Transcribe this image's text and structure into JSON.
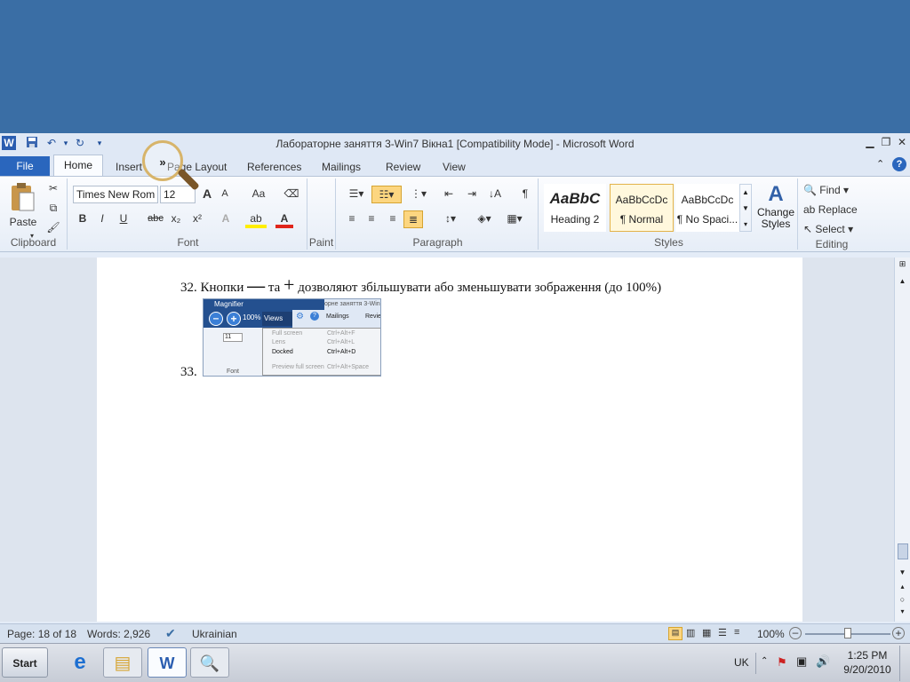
{
  "window": {
    "title": "Лабораторне заняття 3-Win7 Вікна1 [Compatibility Mode]  -  Microsoft Word",
    "app_icon": "W"
  },
  "quick_access": {
    "icons": [
      "word-icon",
      "save-icon",
      "undo-icon",
      "redo-icon",
      "customize-icon"
    ]
  },
  "tabs": [
    "File",
    "Home",
    "Insert",
    "Page Layout",
    "References",
    "Mailings",
    "Review",
    "View"
  ],
  "ribbon": {
    "clipboard": {
      "paste": "Paste",
      "label": "Clipboard"
    },
    "font": {
      "name": "Times New Rom",
      "size": "12",
      "label": "Font",
      "bold": "B",
      "italic": "I",
      "underline": "U",
      "strike": "abc",
      "sub": "x₂",
      "sup": "x²",
      "grow": "A",
      "shrink": "A",
      "case": "Aa"
    },
    "paint": {
      "label": "Paint"
    },
    "paragraph": {
      "label": "Paragraph"
    },
    "styles": {
      "label": "Styles",
      "items": [
        {
          "preview": "AaBbC",
          "name": "Heading 2"
        },
        {
          "preview": "AaBbCcDc",
          "name": "¶ Normal"
        },
        {
          "preview": "AaBbCcDc",
          "name": "¶ No Spaci..."
        }
      ],
      "change": "Change Styles"
    },
    "editing": {
      "label": "Editing",
      "find": "Find",
      "replace": "Replace",
      "select": "Select"
    }
  },
  "document": {
    "line32": {
      "num": "32.",
      "text_a": "Кнопки",
      "minus": "—",
      "text_b": "та",
      "plus": "+",
      "text_c": "дозволяют збільшувати або зменьшувати зображення (до 100%)"
    },
    "line33": {
      "num": "33."
    },
    "magnifier_shot": {
      "title": "Magnifier",
      "zoom": "100%",
      "views": "Views",
      "menu": [
        {
          "label": "Full screen",
          "key": "Ctrl+Alt+F"
        },
        {
          "label": "Lens",
          "key": "Ctrl+Alt+L"
        },
        {
          "label": "Docked",
          "key": "Ctrl+Alt+D"
        },
        {
          "label": "Preview full screen",
          "key": "Ctrl+Alt+Space"
        }
      ],
      "bg_title": "орне заняття 3-Win",
      "bg_tab1": "Mailings",
      "bg_tab2": "Revie",
      "font_size": "11",
      "font_label": "Font"
    }
  },
  "status": {
    "page": "Page: 18 of 18",
    "words": "Words: 2,926",
    "language": "Ukrainian",
    "zoom": "100%"
  },
  "taskbar": {
    "start": "Start",
    "lang": "UK",
    "time": "1:25 PM",
    "date": "9/20/2010"
  }
}
